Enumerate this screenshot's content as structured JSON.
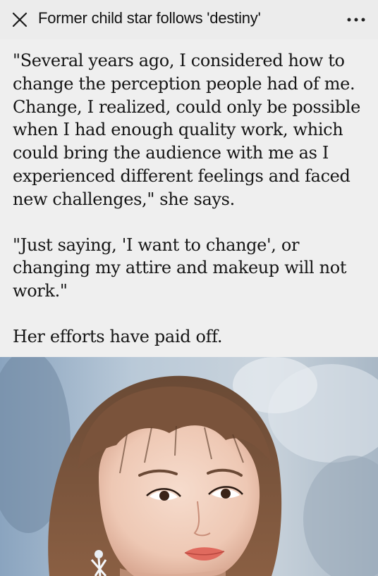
{
  "header": {
    "title": "Former child star follows 'destiny'",
    "close_icon": "close-icon",
    "more_icon": "more-options-icon"
  },
  "article": {
    "paragraphs": [
      "\"Several years ago, I considered how to change the perception people had of me. Change, I realized, could only be possible when I had enough quality work, which could bring the audience with me as I experienced different feelings and faced new challenges,\" she says.",
      "\"Just saying, 'I want to change', or changing my attire and makeup will not work.\"",
      "Her efforts have paid off."
    ]
  },
  "colors": {
    "background": "#efefef",
    "text": "#151515"
  }
}
